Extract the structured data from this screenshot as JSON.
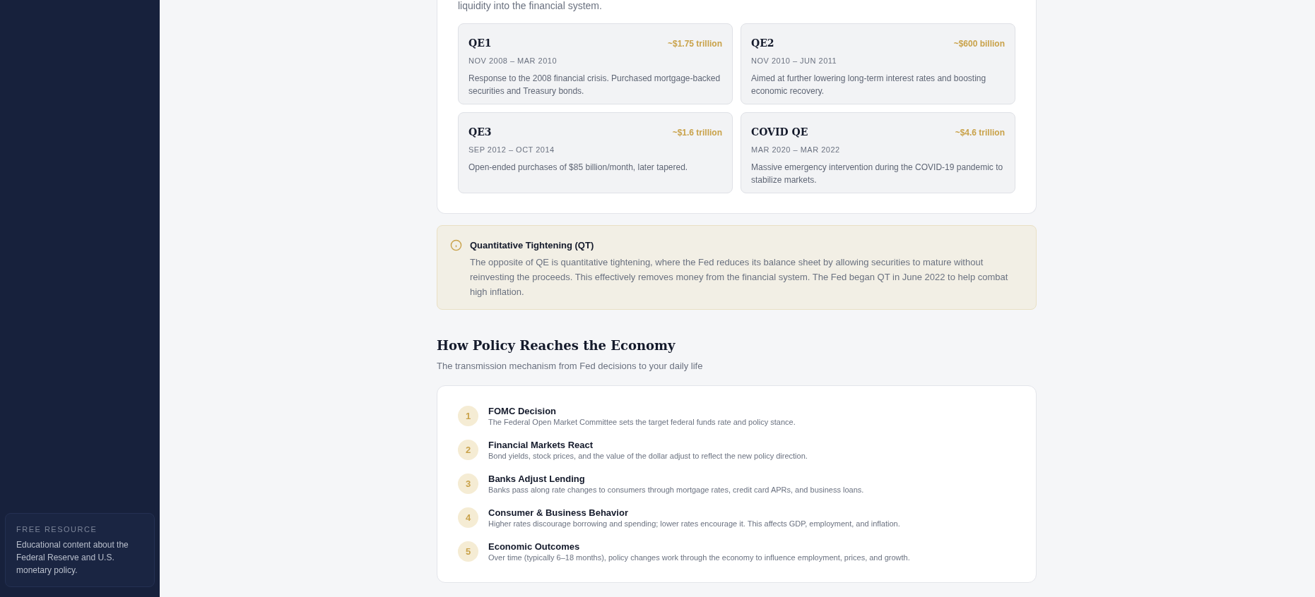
{
  "sidebar": {
    "note": {
      "label": "FREE RESOURCE",
      "text": "Educational content about the Federal Reserve and U.S. monetary policy."
    }
  },
  "qe_section": {
    "intro_tail": "liquidity into the financial system.",
    "programs": [
      {
        "name": "QE1",
        "amount": "~$1.75 trillion",
        "dates": "NOV 2008 – MAR 2010",
        "description": "Response to the 2008 financial crisis. Purchased mortgage-backed securities and Treasury bonds."
      },
      {
        "name": "QE2",
        "amount": "~$600 billion",
        "dates": "NOV 2010 – JUN 2011",
        "description": "Aimed at further lowering long-term interest rates and boosting economic recovery."
      },
      {
        "name": "QE3",
        "amount": "~$1.6 trillion",
        "dates": "SEP 2012 – OCT 2014",
        "description": "Open-ended purchases of $85 billion/month, later tapered."
      },
      {
        "name": "COVID QE",
        "amount": "~$4.6 trillion",
        "dates": "MAR 2020 – MAR 2022",
        "description": "Massive emergency intervention during the COVID-19 pandemic to stabilize markets."
      }
    ]
  },
  "callout": {
    "title": "Quantitative Tightening (QT)",
    "text": "The opposite of QE is quantitative tightening, where the Fed reduces its balance sheet by allowing securities to mature without reinvesting the proceeds. This effectively removes money from the financial system. The Fed began QT in June 2022 to help combat high inflation."
  },
  "transmission": {
    "title": "How Policy Reaches the Economy",
    "subtitle": "The transmission mechanism from Fed decisions to your daily life",
    "steps": [
      {
        "number": "1",
        "title": "FOMC Decision",
        "text": "The Federal Open Market Committee sets the target federal funds rate and policy stance."
      },
      {
        "number": "2",
        "title": "Financial Markets React",
        "text": "Bond yields, stock prices, and the value of the dollar adjust to reflect the new policy direction."
      },
      {
        "number": "3",
        "title": "Banks Adjust Lending",
        "text": "Banks pass along rate changes to consumers through mortgage rates, credit card APRs, and business loans."
      },
      {
        "number": "4",
        "title": "Consumer & Business Behavior",
        "text": "Higher rates discourage borrowing and spending; lower rates encourage it. This affects GDP, employment, and inflation."
      },
      {
        "number": "5",
        "title": "Economic Outcomes",
        "text": "Over time (typically 6–18 months), policy changes work through the economy to influence employment, prices, and growth."
      }
    ]
  }
}
